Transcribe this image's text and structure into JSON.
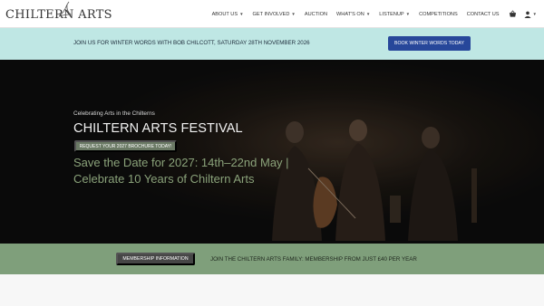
{
  "header": {
    "logo_text": "CHILTERN ARTS",
    "menu": [
      {
        "label": "ABOUT US",
        "has_dropdown": true
      },
      {
        "label": "GET INVOLVED",
        "has_dropdown": true
      },
      {
        "label": "AUCTION",
        "has_dropdown": false
      },
      {
        "label": "WHAT'S ON",
        "has_dropdown": true
      },
      {
        "label": "LISTENUP",
        "has_dropdown": true
      },
      {
        "label": "COMPETITIONS",
        "has_dropdown": false
      },
      {
        "label": "CONTACT US",
        "has_dropdown": false
      }
    ],
    "icons": [
      "basket-icon",
      "user-icon"
    ]
  },
  "announcement": {
    "text": "JOIN US FOR WINTER WORDS WITH BOB CHILCOTT, SATURDAY 28TH NOVEMBER 2026",
    "button_label": "BOOK WINTER WORDS TODAY",
    "bg_color": "#bfe7e4",
    "button_color": "#27479a"
  },
  "hero": {
    "eyebrow": "Celebrating Arts in the Chilterns",
    "title": "CHILTERN ARTS FESTIVAL",
    "button_label": "REQUEST YOUR 2027 BROCHURE TODAY!",
    "subtitle_line1": "Save the Date for 2027: 14th–22nd May |",
    "subtitle_line2": "Celebrate 10 Years of Chiltern Arts",
    "subtitle_color": "#8aa27a"
  },
  "membership": {
    "button_label": "MEMBERSHIP INFORMATION",
    "text": "JOIN THE CHILTERN ARTS FAMILY: MEMBERSHIP FROM JUST £40 PER YEAR",
    "bg_color": "#7f9f7b"
  }
}
